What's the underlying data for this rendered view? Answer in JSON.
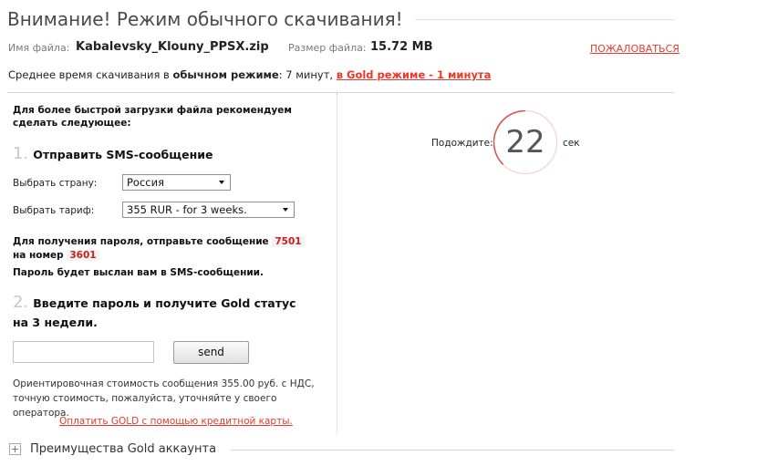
{
  "title": "Внимание! Режим обычного скачивания!",
  "file": {
    "name_label": "Имя файла:",
    "name": "Kabalevsky_Klouny_PPSX.zip",
    "size_label": "Размер файла:",
    "size": "15.72 MB"
  },
  "complain_link": "ПОЖАЛОВАТЬСЯ",
  "avg_time": {
    "prefix": "Среднее время скачивания в",
    "normal_mode": "обычном режиме",
    "normal_value": ": 7 минут,",
    "gold_link": "в Gold режиме - 1 минута"
  },
  "recommend": "Для более быстрой загрузки файла рекомендуем сделать следующее:",
  "step1": {
    "number": "1.",
    "title": "Отправить SMS-сообщение",
    "country_label": "Выбрать страну:",
    "country_value": "Россия",
    "tariff_label": "Выбрать тариф:",
    "tariff_value": "355 RUR - for 3 weeks."
  },
  "sms_info": {
    "text1": "Для получения пароля, отправьте сообщение",
    "code": "7501",
    "text2": "на номер",
    "number": "3601"
  },
  "password_sent": "Пароль будет выслан вам в SMS-сообщении.",
  "step2": {
    "number": "2.",
    "title": "Введите пароль и получите Gold статус на 3 недели."
  },
  "send_button": "send",
  "cost_note": "Ориентировочная стоимость сообщения 355.00 руб. с НДС, точную стоимость, пожалуйста, уточняйте у своего оператора.",
  "pay_card_link": "Оплатить GOLD с помощью кредитной карты.",
  "gold_advantages": "Преимущества Gold аккаунта",
  "countdown": {
    "label": "Подождите:",
    "value": "22",
    "unit": "сек"
  },
  "colors": {
    "accent_red": "#e8392b",
    "code_red": "#c81e1e",
    "ring_red": "#d9534f"
  },
  "icons": {
    "expand": "plus-box-icon",
    "dropdown": "chevron-down-icon"
  }
}
